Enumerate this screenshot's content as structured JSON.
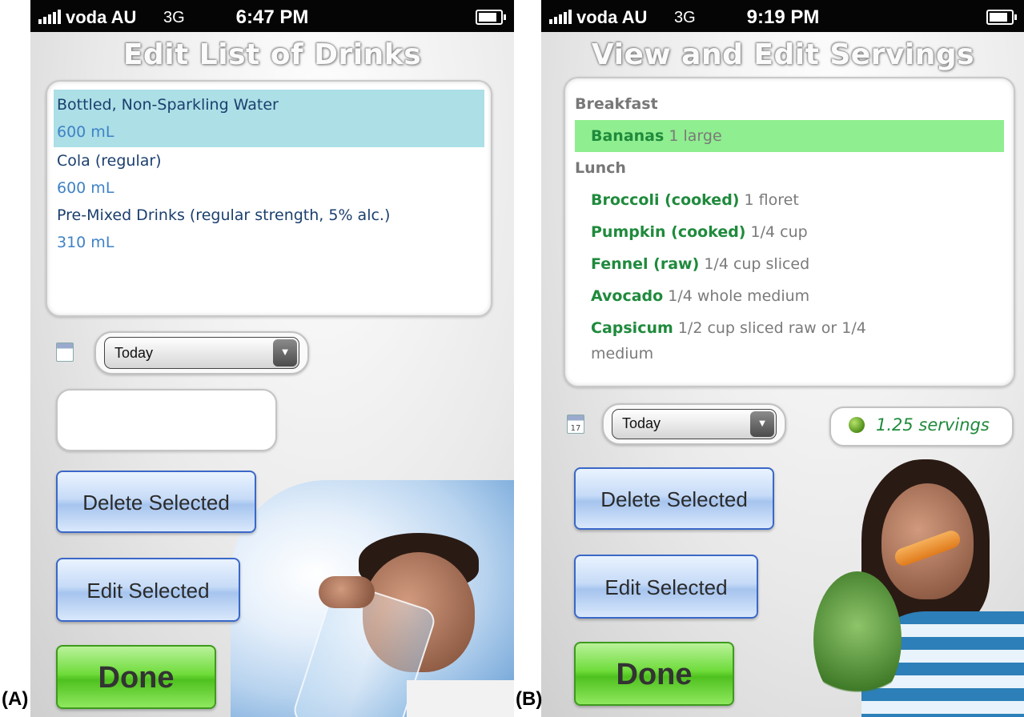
{
  "panels": {
    "a": {
      "label": "(A)",
      "status": {
        "carrier": "voda AU",
        "network": "3G",
        "time": "6:47 PM"
      },
      "title": "Edit List of Drinks",
      "drinks": [
        {
          "name": "Bottled, Non-Sparkling Water",
          "amount": "600 mL",
          "selected": true
        },
        {
          "name": "Cola (regular)",
          "amount": "600 mL",
          "selected": false
        },
        {
          "name": "Pre-Mixed Drinks (regular strength, 5% alc.)",
          "amount": "310 mL",
          "selected": false
        }
      ],
      "date_select": "Today",
      "text_input_value": "",
      "buttons": {
        "delete": "Delete Selected",
        "edit": "Edit Selected",
        "done": "Done"
      }
    },
    "b": {
      "label": "(B)",
      "status": {
        "carrier": "voda AU",
        "network": "3G",
        "time": "9:19 PM"
      },
      "title": "View and Edit Servings",
      "sections": [
        {
          "heading": "Breakfast",
          "items": [
            {
              "name": "Bananas",
              "qty": "1 large",
              "selected": true
            }
          ]
        },
        {
          "heading": "Lunch",
          "items": [
            {
              "name": "Broccoli (cooked)",
              "qty": "1 floret"
            },
            {
              "name": "Pumpkin (cooked)",
              "qty": "1/4 cup"
            },
            {
              "name": "Fennel (raw)",
              "qty": "1/4 cup sliced"
            },
            {
              "name": "Avocado",
              "qty": "1/4 whole medium"
            },
            {
              "name": "Capsicum",
              "qty": "1/2 cup sliced raw or 1/4 medium"
            }
          ]
        }
      ],
      "calendar_day": "17",
      "date_select": "Today",
      "servings": "1.25 servings",
      "buttons": {
        "delete": "Delete Selected",
        "edit": "Edit Selected",
        "done": "Done"
      }
    }
  },
  "colors": {
    "drink_highlight": "#acdfe6",
    "food_highlight": "#8fee8f",
    "food_name": "#1f8a3c",
    "button_blue": "#a6c4ee",
    "button_green": "#4fc11f"
  },
  "icons": [
    "signal-bars-icon",
    "battery-icon",
    "calendar-icon",
    "dropdown-arrow-icon",
    "apple-icon"
  ]
}
